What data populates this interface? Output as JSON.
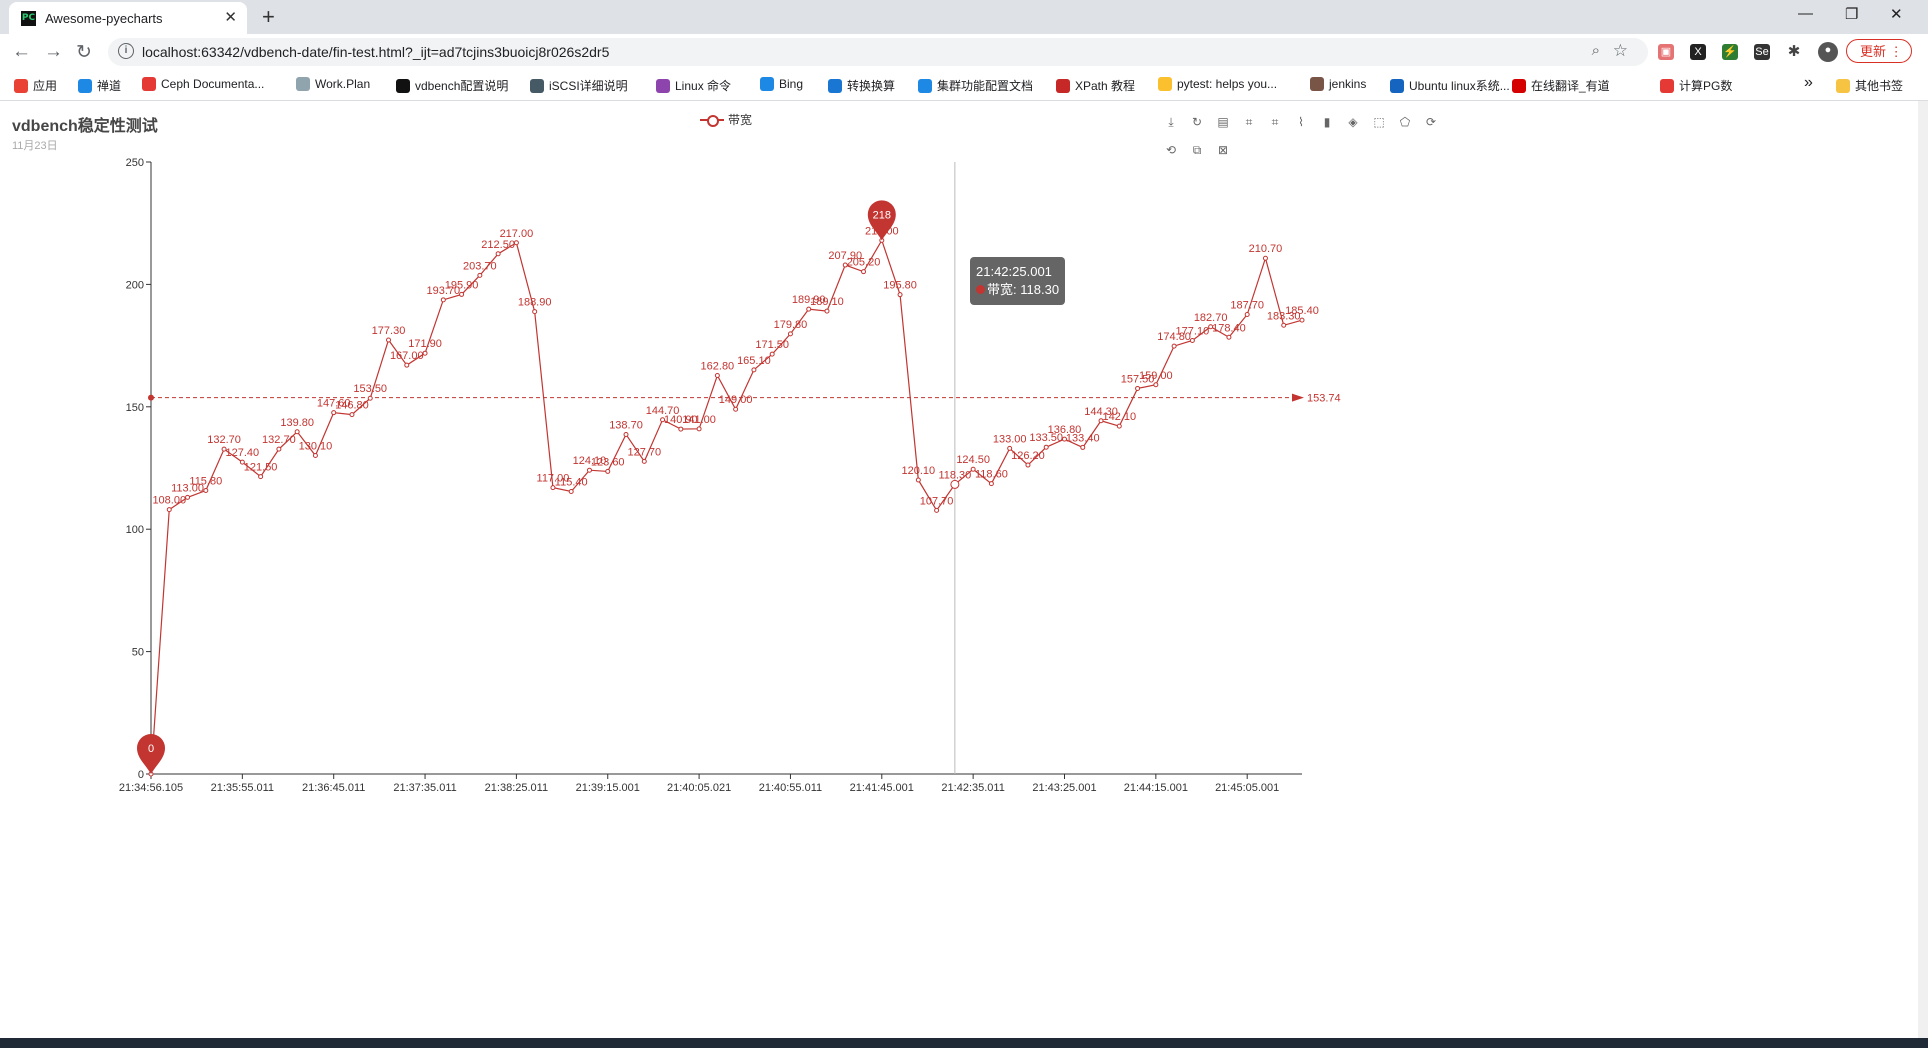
{
  "browser": {
    "tab_title": "Awesome-pyecharts",
    "tab_favicon": "PC",
    "url": "localhost:63342/vdbench-date/fin-test.html?_ijt=ad7tcjins3buoicj8r026s2dr5",
    "update_label": "更新",
    "bookmarks": [
      {
        "label": "应用",
        "icon": "apps-icon",
        "color": "#e94235"
      },
      {
        "label": "禅道",
        "icon": "zentao-icon",
        "color": "#1e88e5"
      },
      {
        "label": "Ceph Documenta...",
        "icon": "ceph-icon",
        "color": "#e53935"
      },
      {
        "label": "Work.Plan",
        "icon": "doc-icon",
        "color": "#90a4ae"
      },
      {
        "label": "vdbench配置说明",
        "icon": "it-icon",
        "color": "#111111"
      },
      {
        "label": "iSCSI详细说明",
        "icon": "fig-icon",
        "color": "#455a64"
      },
      {
        "label": "Linux 命令",
        "icon": "cf-icon",
        "color": "#8e44ad"
      },
      {
        "label": "Bing",
        "icon": "bing-icon",
        "color": "#1e88e5"
      },
      {
        "label": "转换换算",
        "icon": "b-icon",
        "color": "#1976d2"
      },
      {
        "label": "集群功能配置文档",
        "icon": "doc-blue-icon",
        "color": "#1e88e5"
      },
      {
        "label": "XPath 教程",
        "icon": "xpath-icon",
        "color": "#c62828"
      },
      {
        "label": "pytest: helps you...",
        "icon": "pytest-icon",
        "color": "#fbc02d"
      },
      {
        "label": "jenkins",
        "icon": "jenkins-icon",
        "color": "#795548"
      },
      {
        "label": "Ubuntu linux系统...",
        "icon": "zhihu-icon",
        "color": "#1565c0"
      },
      {
        "label": "在线翻译_有道",
        "icon": "youdao-icon",
        "color": "#d50000"
      },
      {
        "label": "计算PG数",
        "icon": "ceph-icon",
        "color": "#e53935"
      }
    ],
    "bookmarks_more": "»",
    "other_bookmarks": "其他书签"
  },
  "chart": {
    "title": "vdbench稳定性测试",
    "subtitle": "11月23日",
    "tooltip_time": "21:42:25.001",
    "tooltip_series": "带宽",
    "tooltip_value": "118.30"
  },
  "chart_data": {
    "type": "line",
    "title": "vdbench稳定性测试",
    "subtitle": "11月23日",
    "x_tick_labels": [
      "21:34:56.105",
      "21:35:55.011",
      "21:36:45.011",
      "21:37:35.011",
      "21:38:25.011",
      "21:39:15.001",
      "21:40:05.021",
      "21:40:55.011",
      "21:41:45.001",
      "21:42:35.011",
      "21:43:25.001",
      "21:44:15.001",
      "21:45:05.001"
    ],
    "ylim": [
      0,
      250
    ],
    "y_ticks": [
      0,
      50,
      100,
      150,
      200,
      250
    ],
    "grid": false,
    "legend_position": "top-center",
    "series": [
      {
        "name": "带宽",
        "color": "#c23531",
        "values": [
          0,
          108.0,
          113.0,
          115.8,
          132.7,
          127.4,
          121.5,
          132.7,
          139.8,
          130.1,
          147.6,
          146.8,
          153.5,
          177.3,
          167.0,
          171.9,
          193.7,
          195.9,
          203.7,
          212.5,
          217.0,
          188.9,
          117.0,
          115.4,
          124.1,
          123.6,
          138.7,
          127.7,
          144.7,
          140.9,
          141.0,
          162.8,
          149.0,
          165.1,
          171.5,
          179.8,
          189.9,
          189.1,
          207.9,
          205.2,
          218.0,
          195.8,
          120.1,
          107.7,
          118.3,
          124.5,
          118.6,
          133.0,
          126.2,
          133.5,
          136.8,
          133.4,
          144.3,
          142.1,
          157.5,
          159.0,
          174.8,
          177.1,
          182.7,
          178.4,
          187.7,
          210.7,
          183.3,
          185.4
        ],
        "labels": [
          "0",
          "108.00",
          "113.00",
          "115.80",
          "132.70",
          "127.40",
          "121.50",
          "132.70",
          "139.80",
          "130.10",
          "147.60",
          "146.80",
          "153.50",
          "177.30",
          "167.00",
          "171.90",
          "193.70",
          "195.90",
          "203.70",
          "212.50",
          "217.00",
          "188.90",
          "117.00",
          "115.40",
          "124.10",
          "123.60",
          "138.70",
          "127.70",
          "144.70",
          "140.90",
          "141.00",
          "162.80",
          "149.00",
          "165.10",
          "171.50",
          "179.80",
          "189.90",
          "189.10",
          "207.90",
          "205.20",
          "218.00",
          "195.80",
          "120.10",
          "107.70",
          "118.30",
          "124.50",
          "118.60",
          "133.00",
          "126.20",
          "133.50",
          "136.80",
          "133.40",
          "144.30",
          "142.10",
          "157.50",
          "159.00",
          "174.80",
          "177.10",
          "182.70",
          "178.40",
          "187.70",
          "210.70",
          "183.30",
          "185.40"
        ],
        "mark_points": [
          {
            "type": "max",
            "value": 218,
            "label": "218"
          },
          {
            "type": "min",
            "value": 0,
            "label": "0"
          }
        ],
        "mark_line": {
          "type": "average",
          "value": 153.74,
          "label": "153.74"
        }
      }
    ]
  }
}
